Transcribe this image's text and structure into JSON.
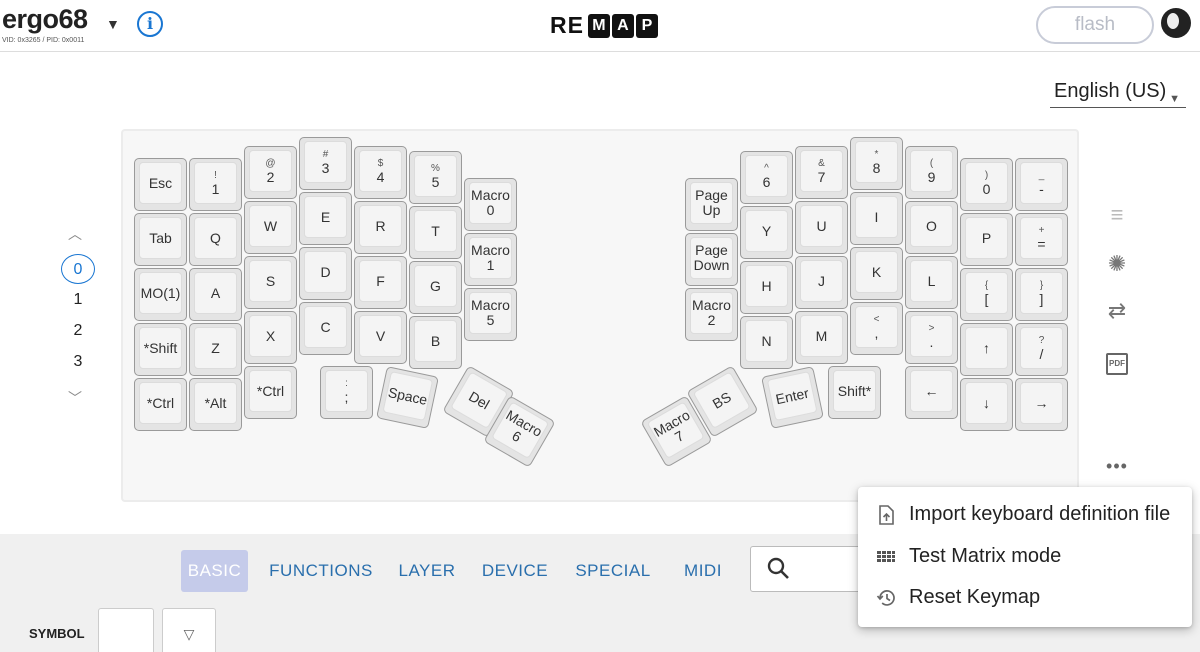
{
  "header": {
    "keyboard_name": "ergo68",
    "vid_pid": "VID: 0x3265 / PID: 0x0011",
    "logo_plain": "RE",
    "logo_boxed": [
      "M",
      "A",
      "P"
    ],
    "flash_label": "flash",
    "info_glyph": "i"
  },
  "language": {
    "selected": "English (US)"
  },
  "layers": {
    "items": [
      "0",
      "1",
      "2",
      "3"
    ],
    "selected": "0"
  },
  "keys": [
    {
      "sub": "",
      "main": "Esc"
    },
    {
      "sub": "!",
      "main": "1"
    },
    {
      "sub": "@",
      "main": "2"
    },
    {
      "sub": "#",
      "main": "3"
    },
    {
      "sub": "$",
      "main": "4"
    },
    {
      "sub": "%",
      "main": "5"
    },
    {
      "sub": "",
      "main": "Macro\n0"
    },
    {
      "sub": "",
      "main": "Tab"
    },
    {
      "sub": "",
      "main": "Q"
    },
    {
      "sub": "",
      "main": "W"
    },
    {
      "sub": "",
      "main": "E"
    },
    {
      "sub": "",
      "main": "R"
    },
    {
      "sub": "",
      "main": "T"
    },
    {
      "sub": "",
      "main": "Macro\n1"
    },
    {
      "sub": "",
      "main": "MO(1)"
    },
    {
      "sub": "",
      "main": "A"
    },
    {
      "sub": "",
      "main": "S"
    },
    {
      "sub": "",
      "main": "D"
    },
    {
      "sub": "",
      "main": "F"
    },
    {
      "sub": "",
      "main": "G"
    },
    {
      "sub": "",
      "main": "Macro\n5"
    },
    {
      "sub": "",
      "main": "*Shift"
    },
    {
      "sub": "",
      "main": "Z"
    },
    {
      "sub": "",
      "main": "X"
    },
    {
      "sub": "",
      "main": "C"
    },
    {
      "sub": "",
      "main": "V"
    },
    {
      "sub": "",
      "main": "B"
    },
    {
      "sub": "",
      "main": "*Ctrl"
    },
    {
      "sub": "",
      "main": "*Alt"
    },
    {
      "sub": "",
      "main": "*Ctrl"
    },
    {
      "sub": ":",
      "main": ";"
    },
    {
      "sub": "",
      "main": "Space"
    },
    {
      "sub": "",
      "main": "Del"
    },
    {
      "sub": "",
      "main": "Macro\n6"
    },
    {
      "sub": "",
      "main": "Page\nUp"
    },
    {
      "sub": "^",
      "main": "6"
    },
    {
      "sub": "&",
      "main": "7"
    },
    {
      "sub": "*",
      "main": "8"
    },
    {
      "sub": "(",
      "main": "9"
    },
    {
      "sub": ")",
      "main": "0"
    },
    {
      "sub": "_",
      "main": "-"
    },
    {
      "sub": "",
      "main": "Page\nDown"
    },
    {
      "sub": "",
      "main": "Y"
    },
    {
      "sub": "",
      "main": "U"
    },
    {
      "sub": "",
      "main": "I"
    },
    {
      "sub": "",
      "main": "O"
    },
    {
      "sub": "",
      "main": "P"
    },
    {
      "sub": "+",
      "main": "="
    },
    {
      "sub": "",
      "main": "Macro\n2"
    },
    {
      "sub": "",
      "main": "H"
    },
    {
      "sub": "",
      "main": "J"
    },
    {
      "sub": "",
      "main": "K"
    },
    {
      "sub": "",
      "main": "L"
    },
    {
      "sub": "{",
      "main": "["
    },
    {
      "sub": "}",
      "main": "]"
    },
    {
      "sub": "",
      "main": "N"
    },
    {
      "sub": "",
      "main": "M"
    },
    {
      "sub": "<",
      "main": ","
    },
    {
      "sub": ">",
      "main": "."
    },
    {
      "sub": "",
      "main": "↑"
    },
    {
      "sub": "?",
      "main": "/"
    },
    {
      "sub": "",
      "main": "Macro\n7"
    },
    {
      "sub": "",
      "main": "BS"
    },
    {
      "sub": "",
      "main": "Enter"
    },
    {
      "sub": "",
      "main": "Shift*"
    },
    {
      "sub": "",
      "main": "←"
    },
    {
      "sub": "",
      "main": "↓"
    },
    {
      "sub": "",
      "main": "→"
    }
  ],
  "tools": {
    "list_icon": "list-icon",
    "light_icon": "backlight-icon",
    "swap_icon": "swap-icon",
    "pdf_label": "PDF",
    "more_label": "•••"
  },
  "tabs": [
    "BASIC",
    "FUNCTIONS",
    "LAYER",
    "DEVICE",
    "SPECIAL",
    "MIDI"
  ],
  "active_tab": "BASIC",
  "symbol": {
    "label": "SYMBOL",
    "dropdown": "▽"
  },
  "menu": {
    "items": [
      {
        "label": "Import keyboard definition file",
        "icon": "file-upload-icon"
      },
      {
        "label": "Test Matrix mode",
        "icon": "grid-icon"
      },
      {
        "label": "Reset Keymap",
        "icon": "history-icon"
      }
    ]
  },
  "colors": {
    "accent": "#1976d2",
    "tab_text": "#2a6fad",
    "tab_active_bg": "#c5cbea"
  }
}
